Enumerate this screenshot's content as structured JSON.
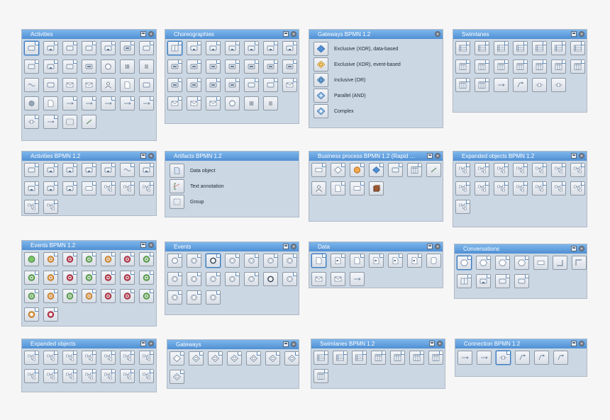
{
  "panels": {
    "activities": {
      "title": "Activities"
    },
    "choreographies": {
      "title": "Choreographies"
    },
    "gateways_bpmn": {
      "title": "Gateways BPMN 1.2",
      "items": [
        {
          "label": "Exclusive (XOR), data-based",
          "icon": "diamond-filled-icon"
        },
        {
          "label": "Exclusive (XOR), event-based",
          "icon": "diamond-pentagon-icon"
        },
        {
          "label": "Inclusive (OR)",
          "icon": "diamond-circle-icon"
        },
        {
          "label": "Parallel (AND)",
          "icon": "diamond-plus-icon"
        },
        {
          "label": "Complex",
          "icon": "diamond-star-icon"
        }
      ]
    },
    "swimlanes": {
      "title": "Swimlanes"
    },
    "activities_bpmn": {
      "title": "Activities BPMN 1.2"
    },
    "artifacts_bpmn": {
      "title": "Artifacts BPMN 1.2",
      "items": [
        {
          "label": "Data object",
          "icon": "document-icon"
        },
        {
          "label": "Text annotation",
          "icon": "text-annotation-icon"
        },
        {
          "label": "Group",
          "icon": "group-icon"
        }
      ]
    },
    "business_process": {
      "title": "Business process BPMN 1.2 (Rapid D..."
    },
    "expanded_objects_bpmn": {
      "title": "Expanded objects BPMN 1.2"
    },
    "events_bpmn": {
      "title": "Events BPMN 1.2"
    },
    "events": {
      "title": "Events"
    },
    "data": {
      "title": "Data"
    },
    "conversations": {
      "title": "Conversations"
    },
    "expanded_objects": {
      "title": "Expanded objects"
    },
    "gateways": {
      "title": "Gateways"
    },
    "swimlanes_bpmn": {
      "title": "Swimlanes BPMN 1.2"
    },
    "connection_bpmn": {
      "title": "Connection BPMN 1.2"
    }
  },
  "colors": {
    "titlebar": "#5d9be0",
    "panel_bg": "#cbd7e3",
    "event_green": "#7cc36c",
    "event_orange": "#f2a84a",
    "event_red": "#d64a5e",
    "gateway_blue": "#4f8fd3"
  }
}
